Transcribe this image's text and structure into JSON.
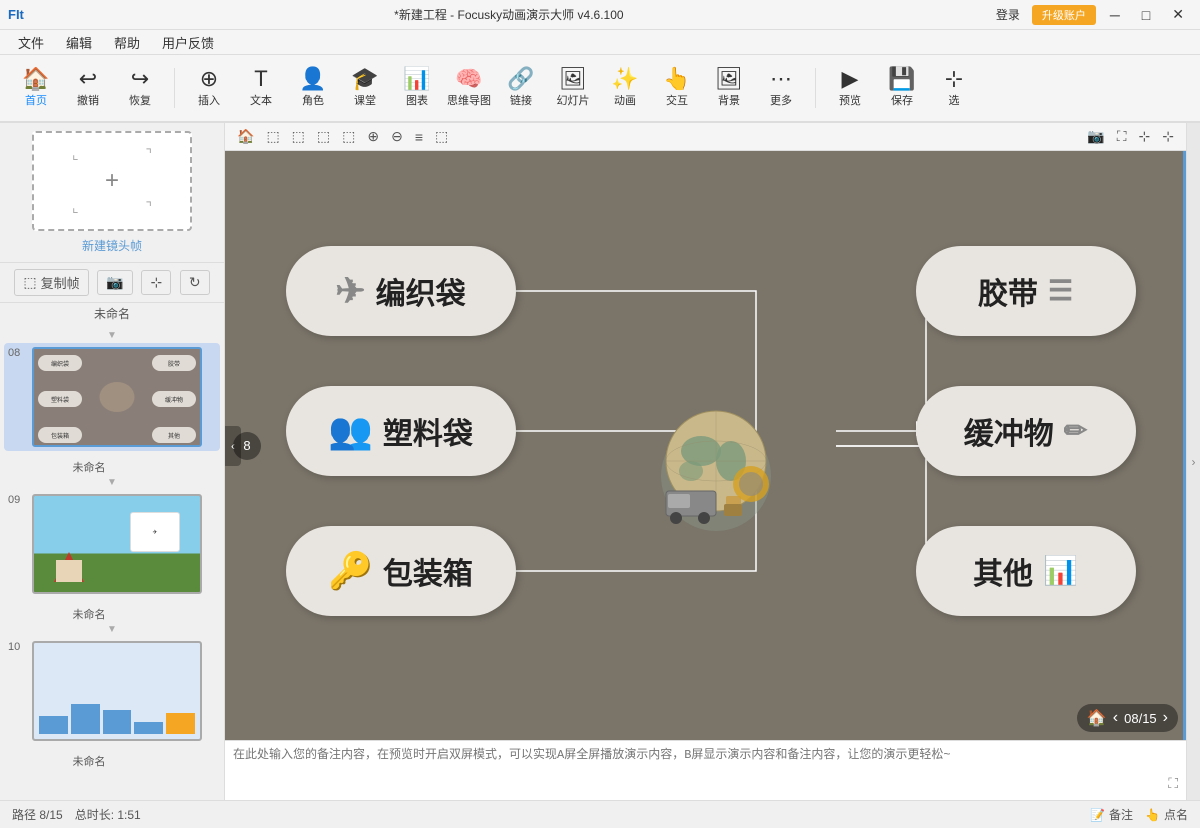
{
  "app": {
    "name": "Focusky动画演示大师",
    "version": "v4.6.100",
    "project": "*新建工程",
    "title_full": "*新建工程 - Focusky动画演示大师  v4.6.100"
  },
  "titlebar": {
    "fit_label": "FIt",
    "login_label": "登录",
    "upgrade_label": "升级账户",
    "minimize": "─",
    "maximize": "□",
    "close": "✕"
  },
  "menubar": {
    "items": [
      "文件",
      "编辑",
      "帮助",
      "用户反馈"
    ]
  },
  "toolbar": {
    "home_label": "首页",
    "undo_label": "撤销",
    "redo_label": "恢复",
    "insert_label": "插入",
    "text_label": "文本",
    "character_label": "角色",
    "class_label": "课堂",
    "chart_label": "图表",
    "mindmap_label": "思维导图",
    "link_label": "链接",
    "slide_label": "幻灯片",
    "animation_label": "动画",
    "interact_label": "交互",
    "background_label": "背景",
    "more_label": "更多",
    "preview_label": "预览",
    "save_label": "保存",
    "select_label": "选"
  },
  "canvas_toolbar": {
    "tools": [
      "🏠",
      "⬚",
      "⬚",
      "⬚",
      "⬚",
      "⊕",
      "⊖",
      "≡",
      "⬚",
      "📷",
      "⬚",
      "⬚"
    ]
  },
  "mindmap": {
    "left_nodes": [
      {
        "id": "bianzhibao",
        "label": "编织袋",
        "icon": "✈"
      },
      {
        "id": "suliaodai",
        "label": "塑料袋",
        "icon": "👥"
      },
      {
        "id": "baozhuangxiang",
        "label": "包装箱",
        "icon": "🔑"
      }
    ],
    "right_nodes": [
      {
        "id": "jiaodai",
        "label": "胶带",
        "icon": "☰"
      },
      {
        "id": "huanchongwu",
        "label": "缓冲物",
        "icon": "✏"
      },
      {
        "id": "qita",
        "label": "其他",
        "icon": "📊"
      }
    ]
  },
  "sidebar": {
    "new_frame_label": "新建镜头帧",
    "copy_frame": "复制帧",
    "slides": [
      {
        "num": "08",
        "name": "未命名",
        "active": true
      },
      {
        "num": "09",
        "name": "未命名",
        "active": false
      },
      {
        "num": "10",
        "name": "未命名",
        "active": false
      }
    ]
  },
  "page_indicator": {
    "current": "08",
    "total": "15",
    "display": "08/15"
  },
  "statusbar": {
    "path": "路径 8/15",
    "duration": "总时长: 1:51",
    "note_label": "备注",
    "point_label": "点名"
  },
  "note": {
    "placeholder": "在此处输入您的备注内容，在预览时开启双屏模式，可以实现A屏全屏播放演示内容，B屏显示演示内容和备注内容，让您的演示更轻松~"
  },
  "colors": {
    "accent": "#5b9bd5",
    "canvas_bg": "#7a7469",
    "box_bg": "#e8e5e0",
    "upgrade_btn": "#f5a623"
  }
}
